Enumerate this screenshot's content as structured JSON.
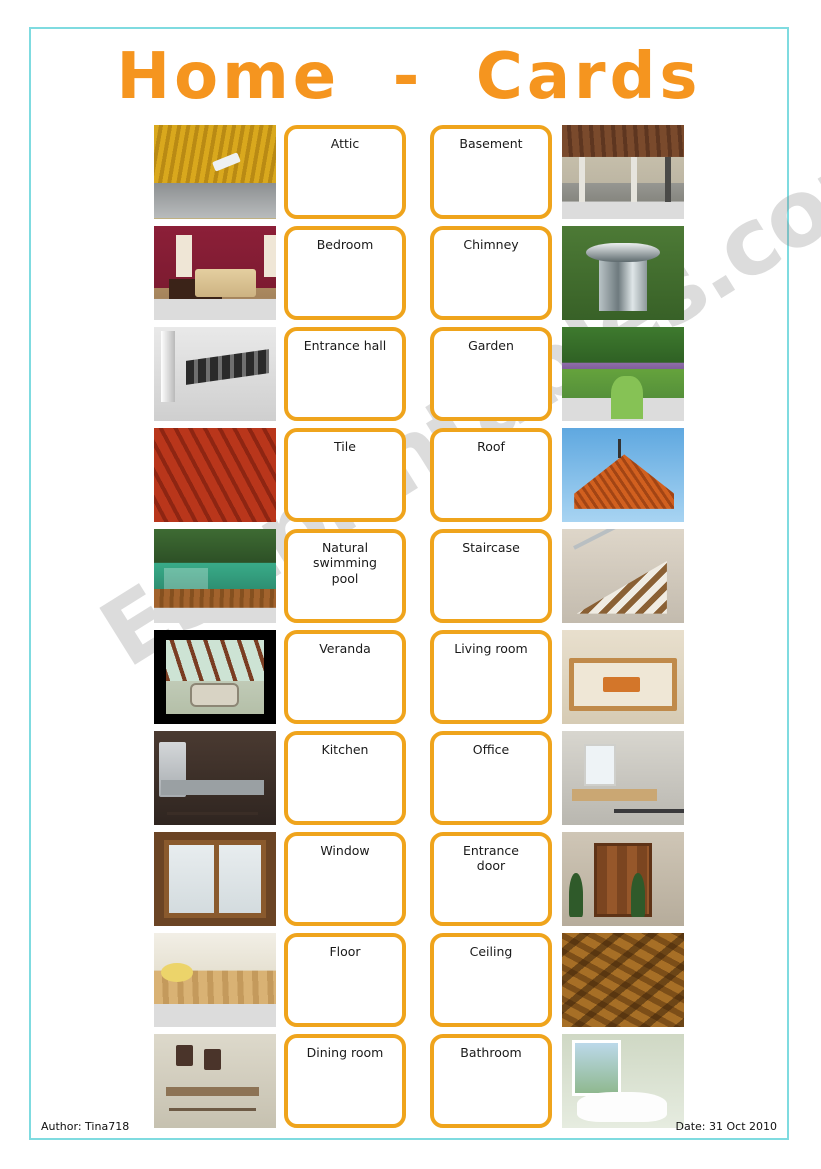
{
  "title": "Home  -  Cards",
  "colors": {
    "title_orange": "#F5951F",
    "card_border_orange": "#EFA41C",
    "page_border_cyan": "#7FDBE0",
    "card_background": "#FFFFFF"
  },
  "watermark": "ESLprintables.com",
  "rows": [
    {
      "left_photo": "attic-photo",
      "left_card": "Attic",
      "right_card": "Basement",
      "right_photo": "basement-photo"
    },
    {
      "left_photo": "bedroom-photo",
      "left_card": "Bedroom",
      "right_card": "Chimney",
      "right_photo": "chimney-photo"
    },
    {
      "left_photo": "entrance-hall-photo",
      "left_card": "Entrance hall",
      "right_card": "Garden",
      "right_photo": "garden-photo"
    },
    {
      "left_photo": "tile-photo",
      "left_card": "Tile",
      "right_card": "Roof",
      "right_photo": "roof-photo"
    },
    {
      "left_photo": "swimming-pool-photo",
      "left_card": "Natural\nswimming\npool",
      "right_card": "Staircase",
      "right_photo": "staircase-photo"
    },
    {
      "left_photo": "veranda-photo",
      "left_card": "Veranda",
      "right_card": "Living room",
      "right_photo": "living-room-photo"
    },
    {
      "left_photo": "kitchen-photo",
      "left_card": "Kitchen",
      "right_card": "Office",
      "right_photo": "office-photo"
    },
    {
      "left_photo": "window-photo",
      "left_card": "Window",
      "right_card": "Entrance\ndoor",
      "right_photo": "entrance-door-photo"
    },
    {
      "left_photo": "floor-photo",
      "left_card": "Floor",
      "right_card": "Ceiling",
      "right_photo": "ceiling-photo"
    },
    {
      "left_photo": "dining-room-photo",
      "left_card": "Dining room",
      "right_card": "Bathroom",
      "right_photo": "bathroom-photo"
    }
  ],
  "footer": {
    "author": "Author: Tina718",
    "date": "Date: 31 Oct 2010"
  }
}
